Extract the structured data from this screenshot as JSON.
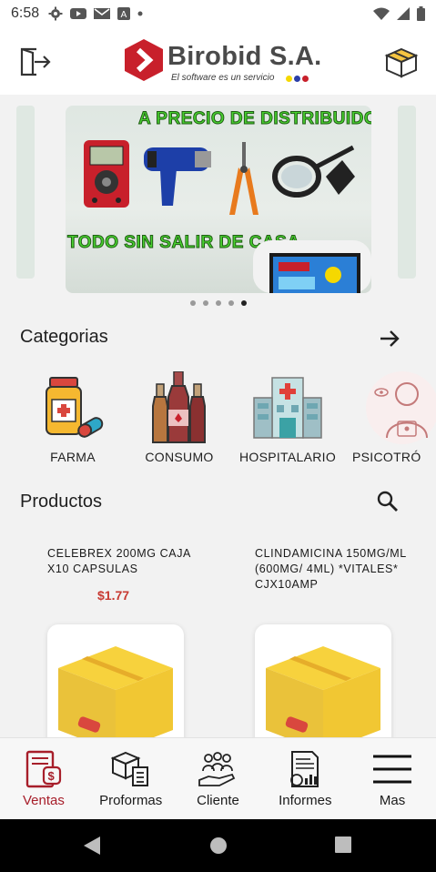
{
  "status_bar": {
    "time": "6:58"
  },
  "header": {
    "brand": "Birobid S.A.",
    "slogan": "El software es un servicio",
    "brand_dots": [
      "#f5d800",
      "#2b3fa8",
      "#c8202b"
    ],
    "brand_color": "#c8202b"
  },
  "banner": {
    "headline_top": "A PRECIO DE DISTRIBUIDOR",
    "headline_bottom": "TODO SIN SALIR DE CASA",
    "page_count": 5,
    "active_index": 4
  },
  "categories": {
    "title": "Categorias",
    "items": [
      {
        "label": "FARMA",
        "icon": "medicine-bottle-icon"
      },
      {
        "label": "CONSUMO",
        "icon": "bottles-icon"
      },
      {
        "label": "HOSPITALARIO",
        "icon": "hospital-icon"
      },
      {
        "label": "PSICOTRÓ",
        "icon": "psychotropic-icon"
      }
    ]
  },
  "products": {
    "title": "Productos",
    "items": [
      {
        "name": "CELEBREX 200MG CAJA X10 CAPSULAS",
        "price": "$1.77",
        "icon": "package-box-icon"
      },
      {
        "name": "CLINDAMICINA 150MG/ML (600MG/ 4ML) *VITALES* CJX10AMP",
        "price": "",
        "icon": "package-box-icon"
      }
    ]
  },
  "bottom_nav": {
    "items": [
      {
        "label": "Ventas",
        "icon": "sales-invoice-icon",
        "active": true
      },
      {
        "label": "Proformas",
        "icon": "proforma-boxes-icon",
        "active": false
      },
      {
        "label": "Cliente",
        "icon": "clients-hand-icon",
        "active": false
      },
      {
        "label": "Informes",
        "icon": "reports-icon",
        "active": false
      },
      {
        "label": "Mas",
        "icon": "hamburger-menu-icon",
        "active": false
      }
    ],
    "active_color": "#a71e2a"
  }
}
